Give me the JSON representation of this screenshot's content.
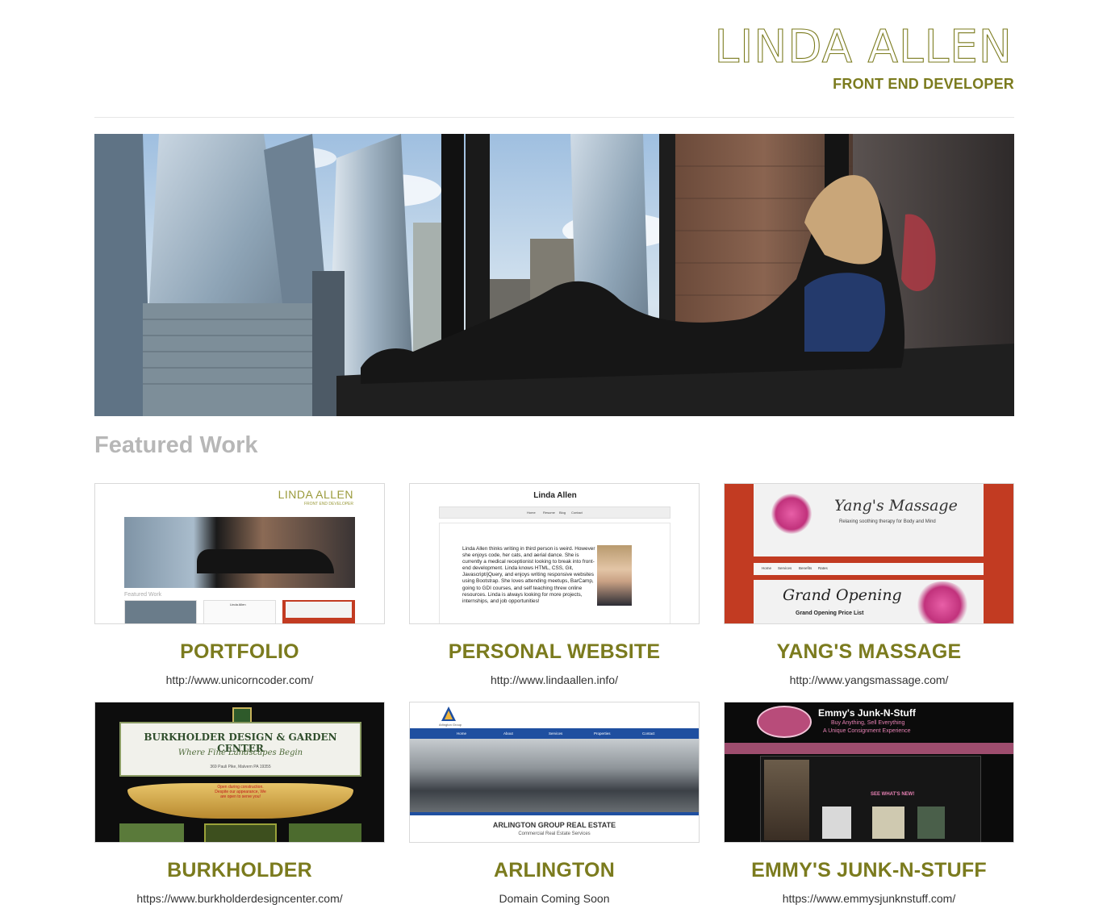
{
  "header": {
    "name": "LINDA ALLEN",
    "tagline": "FRONT END DEVELOPER"
  },
  "featured": {
    "title": "Featured Work"
  },
  "projects": [
    {
      "title": "PORTFOLIO",
      "link": "http://www.unicorncoder.com/",
      "thumb": {
        "name": "LINDA ALLEN",
        "tagline": "FRONT END DEVELOPER",
        "featured": "Featured Work",
        "small_name": "Linda Allen"
      }
    },
    {
      "title": "PERSONAL WEBSITE",
      "link": "http://www.lindaallen.info/",
      "thumb": {
        "heading": "Linda Allen",
        "nav": [
          "Home",
          "Resume",
          "Blog",
          "Contact"
        ],
        "bio": "Linda Allen thinks writing in third person is weird. However she enjoys code, her cats, and aerial dance. She is currently a medical receptionist looking to break into front-end development. Linda knows HTML, CSS, Git, Javascript/jQuery, and enjoys writing responsive websites using Bootstrap. She loves attending meetups, BarCamp, going to GDI courses, and self teaching threw online resources. Linda is always looking for more projects, internships, and job opportunities!"
      }
    },
    {
      "title": "YANG'S MASSAGE",
      "link": "http://www.yangsmassage.com/",
      "thumb": {
        "brand": "Yang's Massage",
        "slogan": "Relaxing soothing therapy for Body and Mind",
        "nav": [
          "Home",
          "Services",
          "Benefits",
          "Rates"
        ],
        "banner": "Grand Opening",
        "price": "Grand Opening Price List"
      }
    },
    {
      "title": "BURKHOLDER",
      "link": "https://www.burkholderdesigncenter.com/",
      "thumb": {
        "brand": "BURKHOLDER DESIGN & GARDEN CENTER",
        "slogan": "Where Fine Landscapes Begin",
        "address": "369 Pauli Pike, Malvern PA 19355",
        "notice": "Open during construction. Despite our appearance, We are open to serve you!"
      }
    },
    {
      "title": "ARLINGTON",
      "link": "Domain Coming Soon",
      "thumb": {
        "logo": "Arlington Group",
        "nav": [
          "Home",
          "About",
          "Services",
          "Properties",
          "Contact"
        ],
        "brand": "ARLINGTON GROUP REAL ESTATE",
        "sub": "Commercial Real Estate Services"
      }
    },
    {
      "title": "EMMY'S JUNK-N-STUFF",
      "link": "https://www.emmysjunknstuff.com/",
      "thumb": {
        "brand": "Emmy's Junk-N-Stuff",
        "line1": "Buy Anything, Sell Everything",
        "line2": "A Unique Consignment Experience",
        "cta": "SEE WHAT'S NEW!"
      }
    }
  ]
}
